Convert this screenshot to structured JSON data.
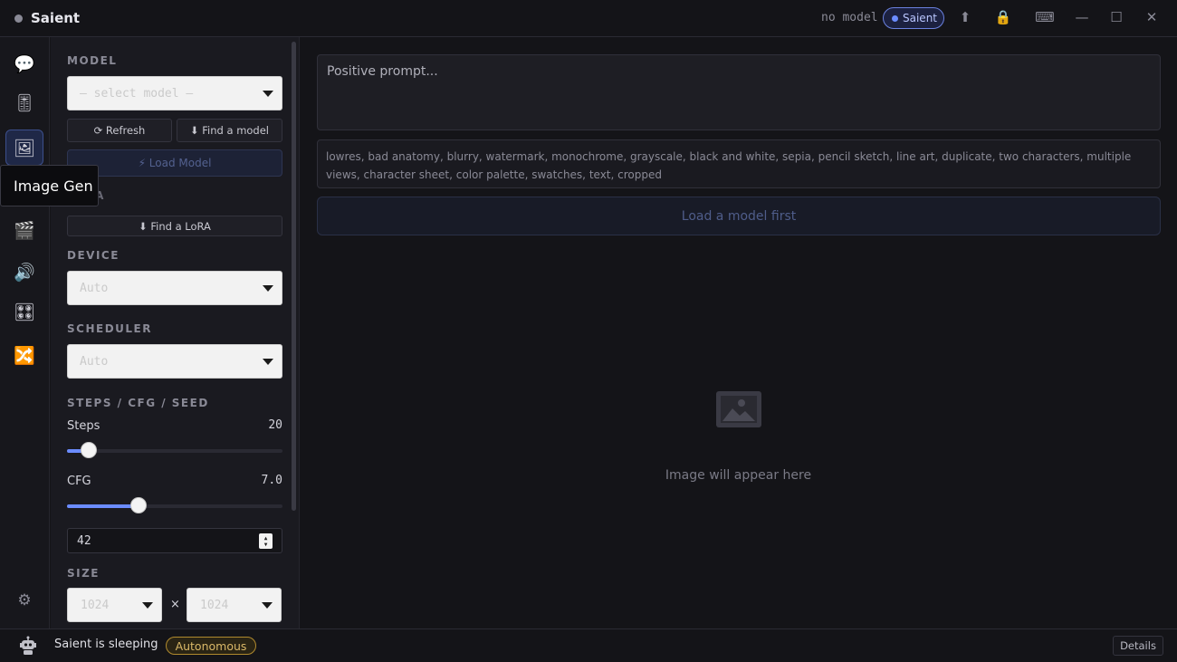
{
  "app": {
    "title": "Saient",
    "model_status": "no model",
    "pill_label": "Saient"
  },
  "titlebar": {
    "icons": [
      "upload-icon",
      "lock-icon",
      "keyboard-icon",
      "minimize-icon",
      "maximize-icon",
      "close-icon"
    ]
  },
  "sidebar": {
    "items": [
      {
        "name": "chat",
        "icon": "💬"
      },
      {
        "name": "server",
        "icon": "🎚"
      },
      {
        "name": "image-gen",
        "icon": "🖼"
      },
      {
        "name": "video",
        "icon": "🎞"
      },
      {
        "name": "film",
        "icon": "🎬"
      },
      {
        "name": "audio",
        "icon": "🔊"
      },
      {
        "name": "apps",
        "icon": "🎛"
      },
      {
        "name": "shuffle",
        "icon": "🔀"
      }
    ],
    "settings_icon": "⚙",
    "tooltip": "Image Gen"
  },
  "settings": {
    "model_label": "MODEL",
    "model_placeholder": "— select model —",
    "refresh_label": "⟳ Refresh",
    "find_model_label": "⬇ Find a model",
    "load_model_label": "⚡ Load Model",
    "lora_label": "LORA",
    "find_lora_label": "⬇ Find a LoRA",
    "device_label": "DEVICE",
    "device_value": "Auto",
    "scheduler_label": "SCHEDULER",
    "scheduler_value": "Auto",
    "steps_cfg_seed_label": "STEPS / CFG / SEED",
    "steps_label": "Steps",
    "steps_value": "20",
    "steps_fraction": 0.1,
    "cfg_label": "CFG",
    "cfg_value": "7.0",
    "cfg_fraction": 0.33,
    "seed_value": "42",
    "size_label": "SIZE",
    "width_value": "1024",
    "height_value": "1024",
    "size_separator": "×"
  },
  "main": {
    "prompt_placeholder": "Positive prompt...",
    "negative_prompt": "lowres, bad anatomy, blurry, watermark, monochrome, grayscale, black and white, sepia, pencil sketch, line art, duplicate, two characters, multiple views, character sheet, color palette, swatches, text, cropped",
    "generate_label": "Load a model first",
    "placeholder_text": "Image will appear here"
  },
  "status": {
    "text": "Saient is sleeping",
    "mode_badge": "Autonomous",
    "details_label": "Details"
  },
  "colors": {
    "accent": "#6b8cff",
    "badge": "#d9b868"
  }
}
